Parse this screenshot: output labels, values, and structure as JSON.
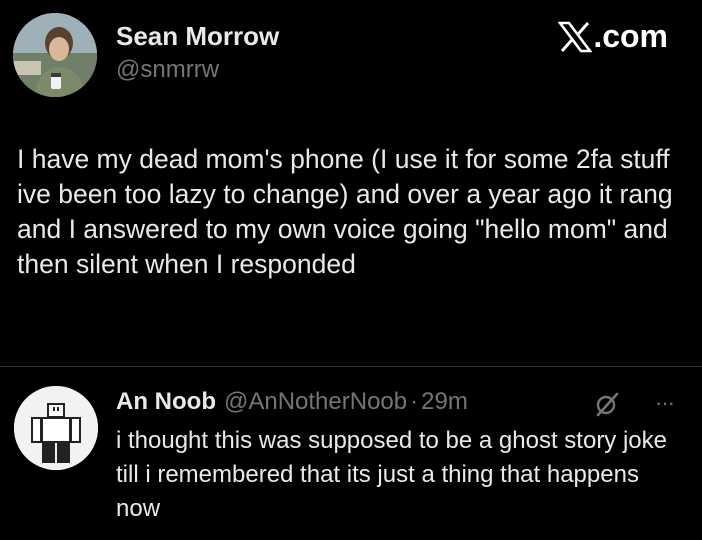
{
  "tweet": {
    "author_name": "Sean Morrow",
    "author_handle": "@snmrrw",
    "text": "I have my dead mom's phone (I use it for some 2fa stuff ive been too lazy to change) and over a year ago it rang and I answered to my own voice going \"hello mom\" and then silent when I responded"
  },
  "brand": {
    "label": ".com"
  },
  "reply": {
    "author_name": "An Noob",
    "author_handle": "@AnNotherNoob",
    "separator": "·",
    "time": "29m",
    "text": "i thought this was supposed to be a ghost story joke till i remembered that its just a thing that happens now",
    "more_label": "···"
  },
  "icons": {
    "brand": "x-logo-icon",
    "grok": "grok-icon",
    "more": "more-options-icon"
  },
  "colors": {
    "background": "#000000",
    "text_primary": "#e7e9ea",
    "text_secondary": "#71767b",
    "divider": "#2f3336"
  }
}
